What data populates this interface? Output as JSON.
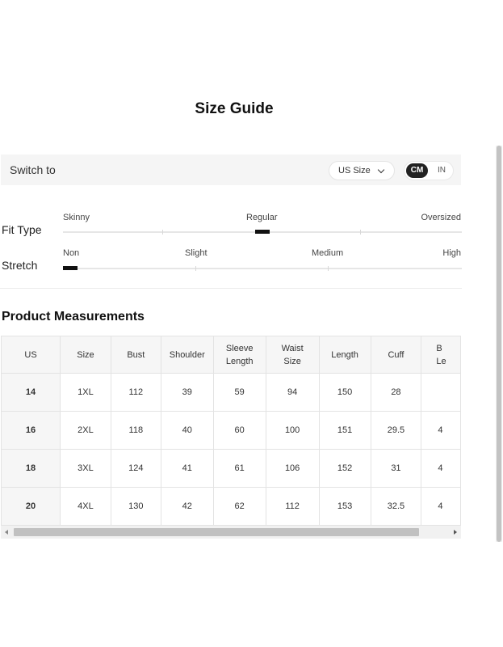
{
  "title": "Size Guide",
  "switch_bar": {
    "label": "Switch to",
    "size_select": "US Size",
    "units": {
      "cm": "CM",
      "in": "IN",
      "selected": "CM"
    }
  },
  "fit_type": {
    "label": "Fit Type",
    "options": [
      "Skinny",
      "Regular",
      "Oversized"
    ],
    "selected": "Regular"
  },
  "stretch": {
    "label": "Stretch",
    "options": [
      "Non",
      "Slight",
      "Medium",
      "High"
    ],
    "selected": "Non"
  },
  "measurements": {
    "title": "Product Measurements",
    "columns": [
      "US",
      "Size",
      "Bust",
      "Shoulder",
      "Sleeve Length",
      "Waist Size",
      "Length",
      "Cuff",
      "B Le"
    ],
    "rows": [
      [
        "14",
        "1XL",
        "112",
        "39",
        "59",
        "94",
        "150",
        "28",
        ""
      ],
      [
        "16",
        "2XL",
        "118",
        "40",
        "60",
        "100",
        "151",
        "29.5",
        "4"
      ],
      [
        "18",
        "3XL",
        "124",
        "41",
        "61",
        "106",
        "152",
        "31",
        "4"
      ],
      [
        "20",
        "4XL",
        "130",
        "42",
        "62",
        "112",
        "153",
        "32.5",
        "4"
      ]
    ]
  },
  "icons": {
    "size_select": "chevron-down-icon",
    "scroll_left": "arrow-left-icon",
    "scroll_right": "arrow-right-icon"
  }
}
